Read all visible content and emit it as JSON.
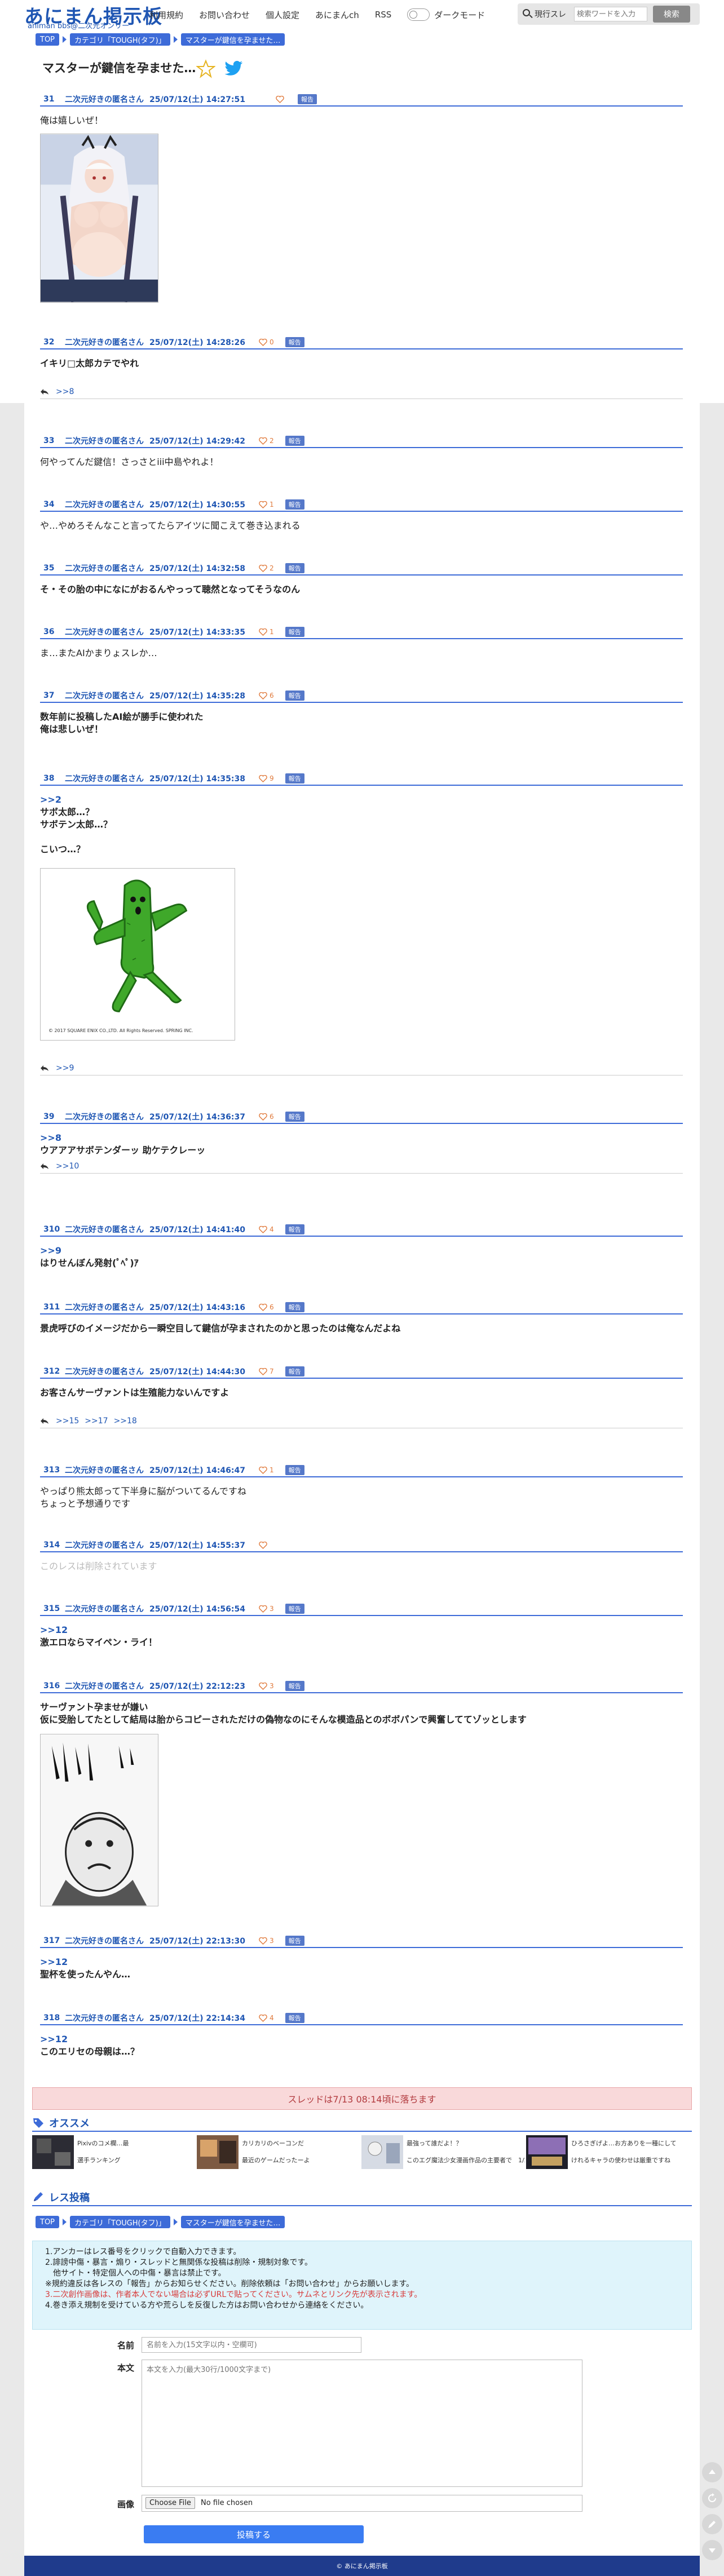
{
  "site": {
    "logo_main": "あにまん掲示板",
    "logo_sub": "animan bbs@二次元オンリー"
  },
  "nav": {
    "items": [
      "利用規約",
      "お問い合わせ",
      "個人設定",
      "あにまんch",
      "RSS"
    ],
    "dark_mode_label": "ダークモード",
    "search_scope": "現行スレ",
    "search_placeholder": "検索ワードを入力",
    "search_button": "検索"
  },
  "breadcrumb": [
    "TOP",
    "カテゴリ「TOUGH(タフ)」",
    "マスターが鍵信を孕ませた…"
  ],
  "thread": {
    "title": "マスターが鍵信を孕ませた…",
    "closed_notice": "スレッドは7/13 08:14頃に落ちます"
  },
  "report_label": "報告",
  "posts": [
    {
      "num": "31",
      "name": "二次元好きの匿名さん",
      "date": "25/07/12(土) 14:27:51",
      "likes": "",
      "lines": [
        "俺は嬉しいぜ！"
      ],
      "bold": false
    },
    {
      "num": "32",
      "name": "二次元好きの匿名さん",
      "date": "25/07/12(土) 14:28:26",
      "likes": "0",
      "lines": [
        "イキリ□太郎カテでやれ"
      ],
      "bold": true,
      "replies": [
        ">>8"
      ]
    },
    {
      "num": "33",
      "name": "二次元好きの匿名さん",
      "date": "25/07/12(土) 14:29:42",
      "likes": "2",
      "lines": [
        "何やってんだ鍵信！さっさとiii中島やれよ！"
      ],
      "bold": false
    },
    {
      "num": "34",
      "name": "二次元好きの匿名さん",
      "date": "25/07/12(土) 14:30:55",
      "likes": "1",
      "lines": [
        "や…やめろそんなこと言ってたらアイツに聞こえて巻き込まれる"
      ],
      "bold": false
    },
    {
      "num": "35",
      "name": "二次元好きの匿名さん",
      "date": "25/07/12(土) 14:32:58",
      "likes": "2",
      "lines": [
        "そ・その胎の中になにがおるんやっって聴然となってそうなのん"
      ],
      "bold": true
    },
    {
      "num": "36",
      "name": "二次元好きの匿名さん",
      "date": "25/07/12(土) 14:33:35",
      "likes": "1",
      "lines": [
        "ま…またAIかまりょスレか…"
      ],
      "bold": false
    },
    {
      "num": "37",
      "name": "二次元好きの匿名さん",
      "date": "25/07/12(土) 14:35:28",
      "likes": "6",
      "lines": [
        "数年前に投稿したAI絵が勝手に使われた",
        "俺は悲しいぜ！"
      ],
      "bold": true
    },
    {
      "num": "38",
      "name": "二次元好きの匿名さん",
      "date": "25/07/12(土) 14:35:38",
      "likes": "9",
      "lines": [
        ">>2",
        "サボ太郎…？",
        "サボテン太郎…？",
        "",
        "こいつ…？"
      ],
      "bold": true,
      "replies": [
        ">>9"
      ],
      "image_caption": "© 2017 SQUARE ENIX CO.,LTD. All Rights Reserved.    SPRING INC."
    },
    {
      "num": "39",
      "name": "二次元好きの匿名さん",
      "date": "25/07/12(土) 14:36:37",
      "likes": "6",
      "lines": [
        ">>8",
        "ウアアアサボテンダーッ 助ケテクレーッ"
      ],
      "bold": true,
      "replies": [
        ">>10"
      ]
    },
    {
      "num": "310",
      "name": "二次元好きの匿名さん",
      "date": "25/07/12(土) 14:41:40",
      "likes": "4",
      "lines": [
        ">>9",
        "はりせんぼん発射(ﾟﾍﾟ)ｱ"
      ],
      "bold": true
    },
    {
      "num": "311",
      "name": "二次元好きの匿名さん",
      "date": "25/07/12(土) 14:43:16",
      "likes": "6",
      "lines": [
        "景虎呼びのイメージだから一瞬空目して鍵信が孕まされたのかと思ったのは俺なんだよね"
      ],
      "bold": true
    },
    {
      "num": "312",
      "name": "二次元好きの匿名さん",
      "date": "25/07/12(土) 14:44:30",
      "likes": "7",
      "lines": [
        "お客さんサーヴァントは生殖能力ないんですよ"
      ],
      "bold": true,
      "replies": [
        ">>15",
        ">>17",
        ">>18"
      ]
    },
    {
      "num": "313",
      "name": "二次元好きの匿名さん",
      "date": "25/07/12(土) 14:46:47",
      "likes": "1",
      "lines": [
        "やっぱり熊太郎って下半身に脳がついてるんですね",
        "ちょっと予想通りです"
      ],
      "bold": false
    },
    {
      "num": "314",
      "name": "二次元好きの匿名さん",
      "date": "25/07/12(土) 14:55:37",
      "likes": "",
      "lines": [
        "このレスは削除されています"
      ],
      "bold": false,
      "deleted": true
    },
    {
      "num": "315",
      "name": "二次元好きの匿名さん",
      "date": "25/07/12(土) 14:56:54",
      "likes": "3",
      "lines": [
        ">>12",
        "激エロならマイペン・ライ！"
      ],
      "bold": true
    },
    {
      "num": "316",
      "name": "二次元好きの匿名さん",
      "date": "25/07/12(土) 22:12:23",
      "likes": "3",
      "lines": [
        "サーヴァント孕ませが嫌い",
        "仮に受胎してたとして結局は胎からコピーされただけの偽物なのにそんな模造品とのボボパンで興奮しててゾッとします"
      ],
      "bold": true
    },
    {
      "num": "317",
      "name": "二次元好きの匿名さん",
      "date": "25/07/12(土) 22:13:30",
      "likes": "3",
      "lines": [
        ">>12",
        "聖杯を使ったんやん…"
      ],
      "bold": true
    },
    {
      "num": "318",
      "name": "二次元好きの匿名さん",
      "date": "25/07/12(土) 22:14:34",
      "likes": "4",
      "lines": [
        ">>12",
        "このエリセの母親は…？"
      ],
      "bold": true
    }
  ],
  "recommend": {
    "heading": "オススメ",
    "items": [
      {
        "title": "Pixivのコメ欄…最",
        "title2": "選手ランキング"
      },
      {
        "title": "カリカリのベーコンだ",
        "title2": "最近のゲームだったーよ"
      },
      {
        "title": "最強って誰だよ！？",
        "title2": "このエグ魔法少女漫画作品の主要者で　1/2 3話"
      },
      {
        "title": "ひろさぎげよ…お方ありを一種にして",
        "title2": "けれるキャラの使わせは厳重ですね"
      }
    ]
  },
  "reply_form": {
    "heading": "レス投稿",
    "rules": [
      {
        "text": "1.アンカーはレス番号をクリックで自動入力できます。",
        "red": false
      },
      {
        "text": "2.誹謗中傷・暴言・煽り・スレッドと無関係な投稿は削除・規制対象です。",
        "red": false
      },
      {
        "text": "　他サイト・特定個人への中傷・暴言は禁止です。",
        "red": false
      },
      {
        "text": "※規約違反は各レスの「報告」からお知らせください。削除依頼は「お問い合わせ」からお願いします。",
        "red": false
      },
      {
        "text": "3.二次創作画像は、作者本人でない場合は必ずURLで貼ってください。サムネとリンク先が表示されます。",
        "red": true
      },
      {
        "text": "4.巻き添え規制を受けている方や荒らしを反復した方はお問い合わせから連絡をください。",
        "red": false
      }
    ],
    "name_label": "名前",
    "name_placeholder": "名前を入力(15文字以内・空欄可)",
    "body_label": "本文",
    "body_placeholder": "本文を入力(最大30行/1000文字まで)",
    "image_label": "画像",
    "file_button": "Choose File",
    "file_status": "No file chosen",
    "submit": "投稿する"
  },
  "footer": "© あにまん掲示板",
  "colors": {
    "accent": "#3d6bd8",
    "link": "#1f56b3",
    "heart": "#e07a3c",
    "notice_bg": "#f9d9da",
    "rules_bg": "#dff4fb",
    "footer": "#1f3b8c"
  }
}
